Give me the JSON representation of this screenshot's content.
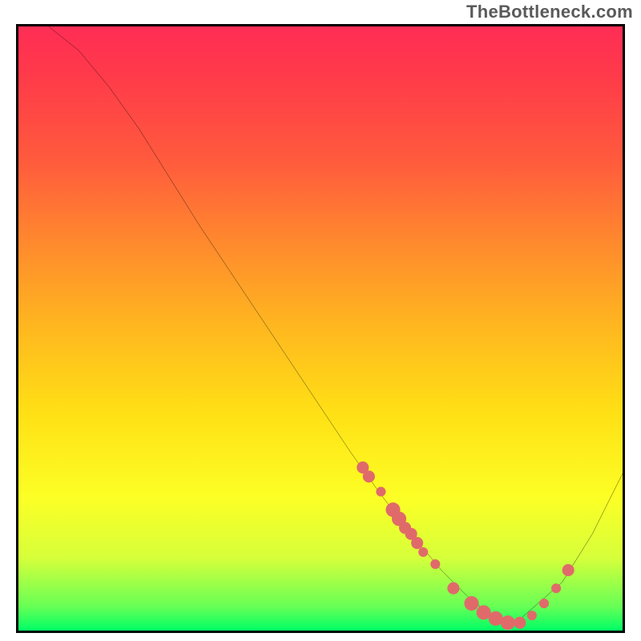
{
  "watermark": "TheBottleneck.com",
  "chart_data": {
    "type": "line",
    "title": "",
    "xlabel": "",
    "ylabel": "",
    "xlim": [
      0,
      100
    ],
    "ylim": [
      0,
      100
    ],
    "grid": false,
    "legend": false,
    "background_gradient": {
      "direction": "vertical",
      "stops": [
        {
          "pos": 0,
          "color": "#ff2d55"
        },
        {
          "pos": 0.22,
          "color": "#ff5a3d"
        },
        {
          "pos": 0.5,
          "color": "#ffb81f"
        },
        {
          "pos": 0.78,
          "color": "#fcff25"
        },
        {
          "pos": 1.0,
          "color": "#00ff66"
        }
      ]
    },
    "series": [
      {
        "name": "curve",
        "color": "#000000",
        "x": [
          5,
          10,
          15,
          20,
          25,
          30,
          35,
          40,
          45,
          50,
          55,
          60,
          65,
          70,
          75,
          80,
          82,
          90,
          95,
          100
        ],
        "y": [
          100,
          96,
          90,
          83,
          75,
          67,
          59.5,
          52,
          44.5,
          37,
          29.5,
          22.5,
          16,
          10,
          5,
          1.5,
          1,
          8,
          16,
          26
        ]
      }
    ],
    "scatter_overlay": {
      "name": "highlight-dots",
      "color": "#e06a6a",
      "points": [
        {
          "x": 57,
          "y": 27,
          "r": 1.0
        },
        {
          "x": 58,
          "y": 25.5,
          "r": 1.0
        },
        {
          "x": 60,
          "y": 23,
          "r": 0.8
        },
        {
          "x": 62,
          "y": 20,
          "r": 1.2
        },
        {
          "x": 63,
          "y": 18.5,
          "r": 1.2
        },
        {
          "x": 64,
          "y": 17,
          "r": 1.0
        },
        {
          "x": 65,
          "y": 16,
          "r": 1.0
        },
        {
          "x": 66,
          "y": 14.5,
          "r": 1.0
        },
        {
          "x": 67,
          "y": 13,
          "r": 0.8
        },
        {
          "x": 69,
          "y": 11,
          "r": 0.8
        },
        {
          "x": 72,
          "y": 7,
          "r": 1.0
        },
        {
          "x": 75,
          "y": 4.5,
          "r": 1.2
        },
        {
          "x": 77,
          "y": 3,
          "r": 1.2
        },
        {
          "x": 79,
          "y": 2,
          "r": 1.2
        },
        {
          "x": 81,
          "y": 1.3,
          "r": 1.2
        },
        {
          "x": 83,
          "y": 1.3,
          "r": 1.0
        },
        {
          "x": 85,
          "y": 2.5,
          "r": 0.8
        },
        {
          "x": 87,
          "y": 4.5,
          "r": 0.8
        },
        {
          "x": 89,
          "y": 7,
          "r": 0.8
        },
        {
          "x": 91,
          "y": 10,
          "r": 1.0
        }
      ]
    }
  }
}
